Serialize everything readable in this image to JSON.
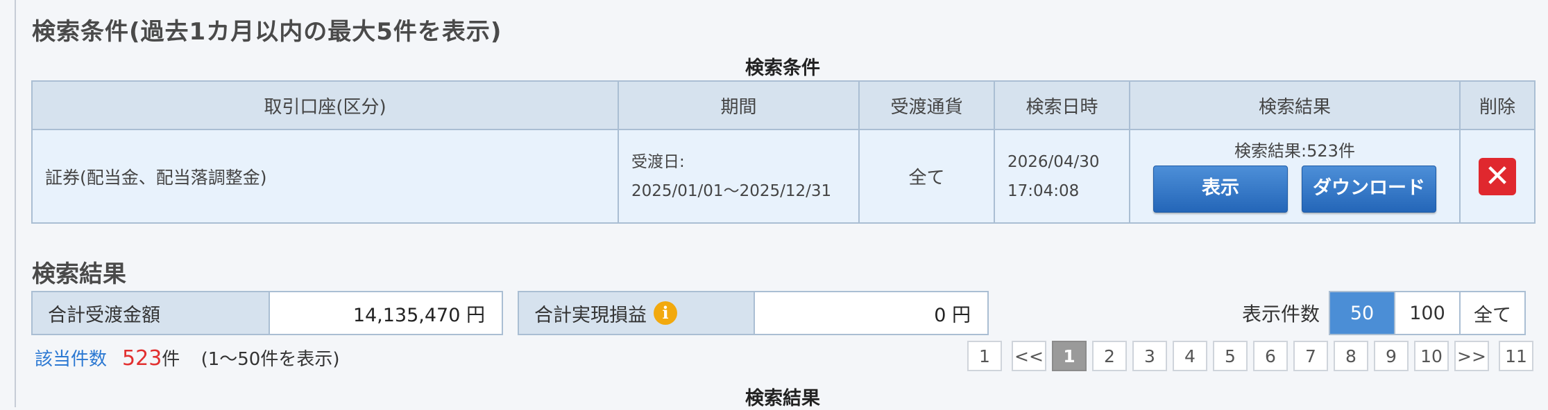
{
  "conditions_section": {
    "title": "検索条件(過去1カ月以内の最大5件を表示)",
    "table_caption": "検索条件",
    "headers": [
      "取引口座(区分)",
      "期間",
      "受渡通貨",
      "検索日時",
      "検索結果",
      "削除"
    ],
    "row": {
      "account": "証券(配当金、配当落調整金)",
      "period_label": "受渡日:",
      "period_range": "2025/01/01〜2025/12/31",
      "currency": "全て",
      "search_date": "2026/04/30",
      "search_time": "17:04:08",
      "result_text": "検索結果:523件",
      "show_button": "表示",
      "download_button": "ダウンロード",
      "delete_icon": "close-icon"
    }
  },
  "results_section": {
    "title": "検索結果",
    "total_amount_label": "合計受渡金額",
    "total_amount_value": "14,135,470 円",
    "total_pl_label": "合計実現損益",
    "total_pl_value": "0 円",
    "info_icon": "i",
    "display_count_label": "表示件数",
    "display_options": [
      "50",
      "100",
      "全て"
    ],
    "display_selected": "50",
    "hit_count_label": "該当件数",
    "hit_count_value": "523",
    "hit_count_unit": "件",
    "hit_count_range": "(1〜50件を表示)",
    "pager": {
      "first": "1",
      "prev": "<<",
      "pages": [
        "1",
        "2",
        "3",
        "4",
        "5",
        "6",
        "7",
        "8",
        "9",
        "10"
      ],
      "current": "1",
      "next": ">>",
      "last": "11"
    },
    "table_caption": "検索結果"
  }
}
